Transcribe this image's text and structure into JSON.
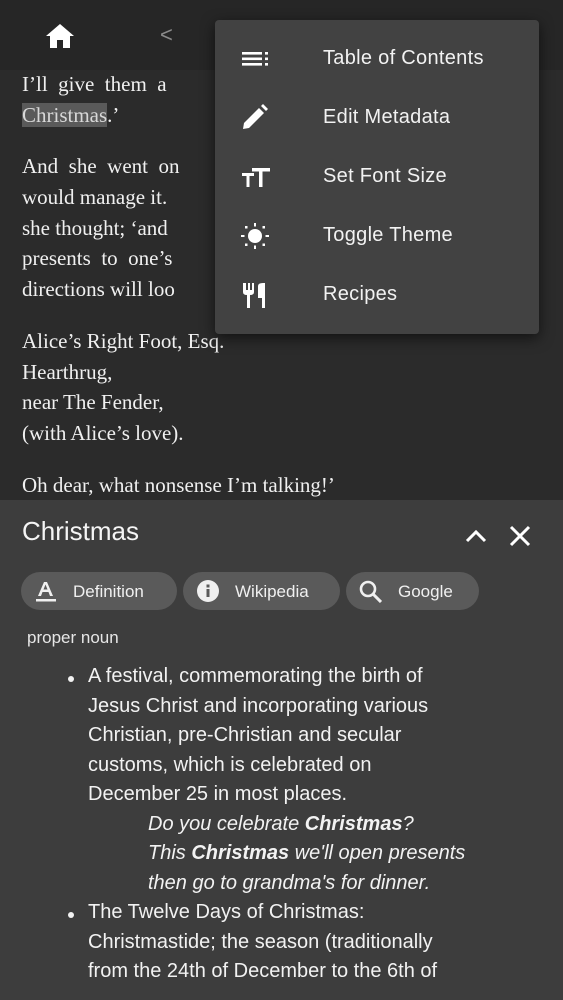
{
  "topbar": {
    "home_icon": "home-icon",
    "back_icon": "chevron-left-icon",
    "back_glyph": "<"
  },
  "reader": {
    "lines": [
      "I’ll  give  them  a",
      ".’",
      "And  she  went  on",
      "would manage it.",
      "she thought; ‘and",
      "presents  to  one’s",
      "directions will loo",
      "Alice’s Right Foot, Esq.",
      "Hearthrug,",
      "near The Fender,",
      "(with Alice’s love).",
      "Oh dear, what nonsense I’m talking!’"
    ],
    "highlighted_word": "Christmas"
  },
  "menu": {
    "items": [
      {
        "label": "Table of Contents",
        "icon": "toc-icon"
      },
      {
        "label": "Edit Metadata",
        "icon": "pencil-icon"
      },
      {
        "label": "Set Font Size",
        "icon": "font-size-icon"
      },
      {
        "label": "Toggle Theme",
        "icon": "brightness-icon"
      },
      {
        "label": "Recipes",
        "icon": "utensils-icon"
      }
    ]
  },
  "dictionary": {
    "word": "Christmas",
    "collapse_icon": "chevron-up-icon",
    "close_icon": "close-icon",
    "tabs": [
      {
        "label": "Definition",
        "icon": "definition-icon"
      },
      {
        "label": "Wikipedia",
        "icon": "info-icon"
      },
      {
        "label": "Google",
        "icon": "search-icon"
      }
    ],
    "part_of_speech": "proper noun",
    "definitions": [
      {
        "lines": [
          "A festival, commemorating the birth of",
          "Jesus Christ and incorporating various",
          "Christian, pre-Christian and secular",
          "customs, which is celebrated on",
          "December 25 in most places."
        ],
        "examples": [
          {
            "pre": "Do you celebrate ",
            "term": "Christmas",
            "post": "?"
          },
          {
            "pre": "This ",
            "term": "Christmas",
            "post": " we'll open presents"
          },
          {
            "pre": "then go to grandma's for dinner.",
            "term": "",
            "post": ""
          }
        ]
      },
      {
        "lines": [
          "The Twelve Days of Christmas:",
          "Christmastide; the season (traditionally",
          "from the 24th of December to the 6th of"
        ]
      }
    ]
  }
}
